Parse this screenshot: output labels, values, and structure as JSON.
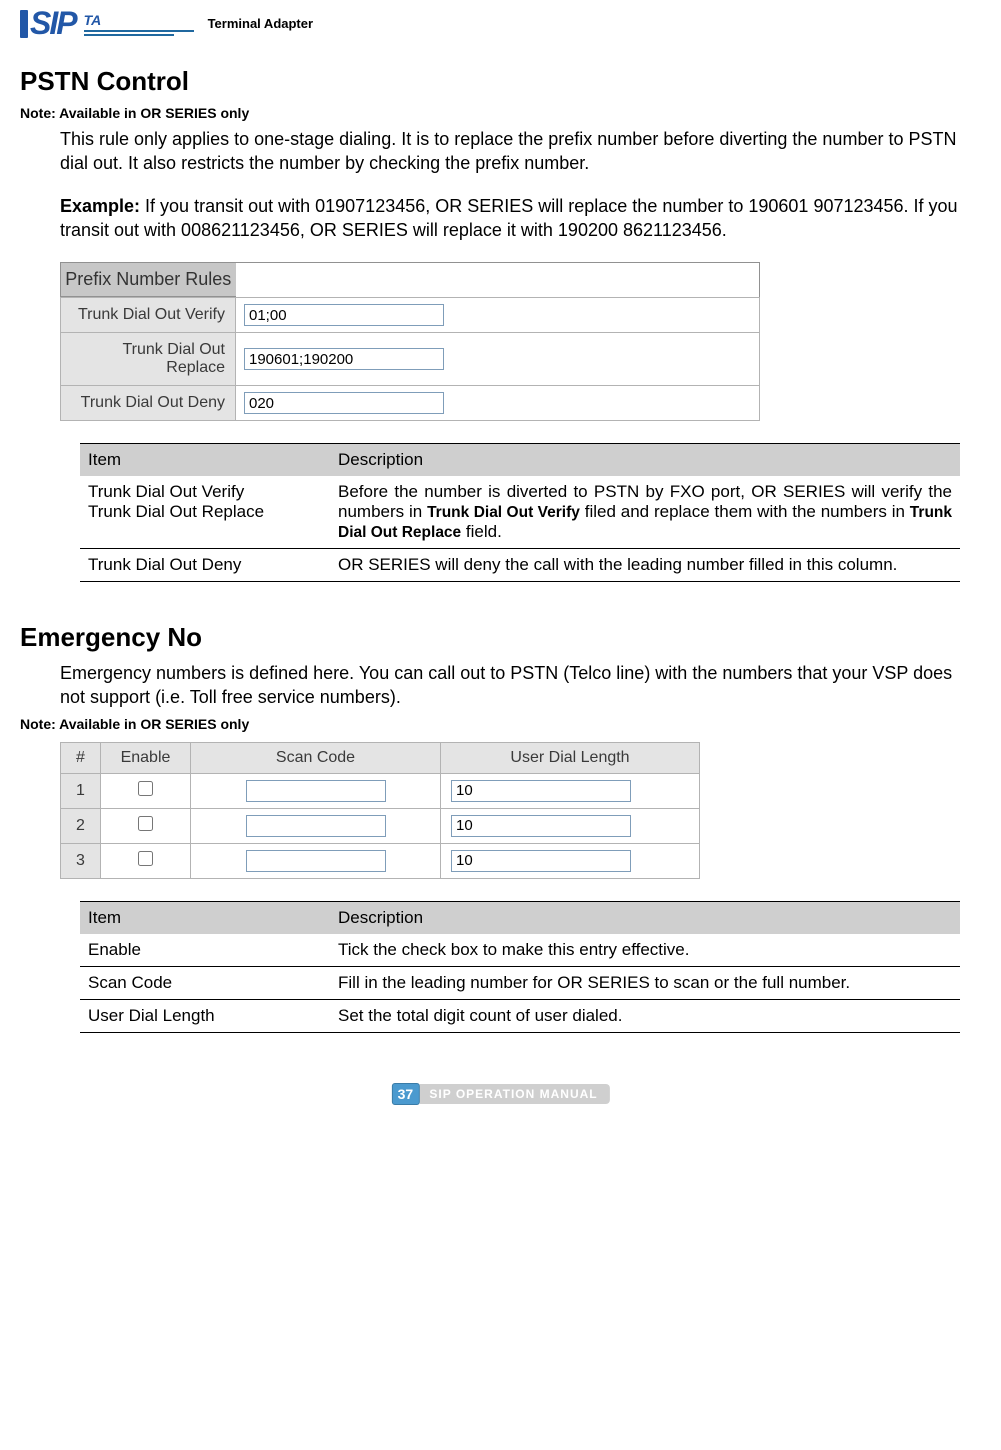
{
  "header": {
    "brand_text": "SIP",
    "sub_text": "TA",
    "product_line": "Terminal Adapter"
  },
  "pstn": {
    "title": "PSTN Control",
    "note": "Note: Available in OR SERIES only",
    "intro": "This rule only applies to one-stage dialing. It is to replace the prefix number before diverting the number to PSTN dial out. It also restricts the number by checking the prefix number.",
    "example_label": "Example:",
    "example_text": " If you transit out with 01907123456, OR SERIES will replace the number to 190601 907123456. If you transit out with 008621123456, OR SERIES will replace it with 190200 8621123456.",
    "panel_title": "Prefix Number Rules",
    "rows": [
      {
        "label": "Trunk Dial Out Verify",
        "value": "01;00"
      },
      {
        "label": "Trunk Dial Out Replace",
        "value": "190601;190200"
      },
      {
        "label": "Trunk Dial Out Deny",
        "value": "020"
      }
    ],
    "desc_header_item": "Item",
    "desc_header_desc": "Description",
    "desc_rows": [
      {
        "item_line1": "Trunk Dial Out Verify",
        "item_line2": "Trunk Dial Out Replace",
        "desc_pre": "Before the number is diverted to PSTN by FXO port, OR SERIES will verify the numbers in ",
        "desc_emph1": "Trunk Dial Out Verify",
        "desc_mid": " filed and replace them with the numbers in ",
        "desc_emph2": "Trunk Dial Out Replace",
        "desc_post": " field."
      },
      {
        "item": "Trunk Dial Out Deny",
        "desc": "OR SERIES will deny the call with the leading number filled in this column."
      }
    ]
  },
  "emergency": {
    "title": "Emergency No",
    "intro": "Emergency numbers is defined here. You can call out to PSTN (Telco line) with the numbers that your VSP does not support (i.e. Toll free service numbers).",
    "note": "Note: Available in OR SERIES only",
    "cols": {
      "num": "#",
      "enable": "Enable",
      "scan": "Scan Code",
      "udl": "User Dial Length"
    },
    "rows": [
      {
        "n": "1",
        "enable": false,
        "scan": "",
        "udl": "10"
      },
      {
        "n": "2",
        "enable": false,
        "scan": "",
        "udl": "10"
      },
      {
        "n": "3",
        "enable": false,
        "scan": "",
        "udl": "10"
      }
    ],
    "desc_header_item": "Item",
    "desc_header_desc": "Description",
    "desc_rows": [
      {
        "item": "Enable",
        "desc": "Tick the check box to make this entry effective."
      },
      {
        "item": "Scan Code",
        "desc": "Fill in the leading number for OR SERIES to scan or the full number."
      },
      {
        "item": "User Dial Length",
        "desc": "Set the total digit count of user dialed."
      }
    ]
  },
  "footer": {
    "page": "37",
    "label": "SIP OPERATION MANUAL"
  }
}
